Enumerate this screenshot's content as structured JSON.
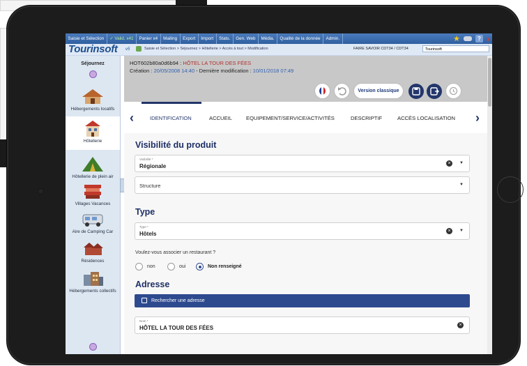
{
  "menu": {
    "items": [
      "Saisie et Sélection",
      "Valid. x41",
      "Panier x4",
      "Mailing",
      "Export",
      "Import",
      "Stats.",
      "Gen. Web",
      "Média.",
      "Qualité de la donnée",
      "Admin."
    ],
    "help_label": "?",
    "close_label": "x"
  },
  "brand": {
    "logo": "Tourinsoft",
    "version": "v5",
    "breadcrumb": "Saisie et Sélection > Séjournez > Hôtellerie > Accès à tout > Modification",
    "faire_savoir": "FAIRE SAVOIR CDT34 / CDT34",
    "tourinsoft_select": "Tourinsoft"
  },
  "sidebar": {
    "title": "Séjournez",
    "items": [
      {
        "label": "Hébergements locatifs",
        "icon": "chalet-icon"
      },
      {
        "label": "Hôtellerie",
        "icon": "hotel-icon",
        "active": true
      },
      {
        "label": "Hôtellerie de plein air",
        "icon": "tent-icon"
      },
      {
        "label": "Villages Vacances",
        "icon": "bungalow-icon"
      },
      {
        "label": "Aire de Camping Car",
        "icon": "camper-icon"
      },
      {
        "label": "Résidences",
        "icon": "houses-icon"
      },
      {
        "label": "Hébergements collectifs",
        "icon": "buildings-icon"
      }
    ]
  },
  "header": {
    "id_code": "HOT602b80a0d6b94 : ",
    "id_name": "HÔTEL LA TOUR DES FÉES",
    "creation_label": "Création : ",
    "creation_date": "20/05/2008 14:40",
    "modif_label": " - Dernière modification : ",
    "modif_date": "10/01/2018 07:49",
    "version_button": "Version classique"
  },
  "tabs": {
    "items": [
      "IDENTIFICATION",
      "ACCUEIL",
      "EQUIPEMENT/SERVICE/ACTIVITÉS",
      "DESCRIPTIF",
      "ACCÈS LOCALISATION"
    ],
    "active": "IDENTIFICATION"
  },
  "form": {
    "visibility_title": "Visibilité du produit",
    "visibility_label": "Visibilité *",
    "visibility_value": "Régionale",
    "structure_placeholder": "Structure",
    "type_title": "Type",
    "type_label": "Type *",
    "type_value": "Hôtels",
    "restaurant_question": "Voulez-vous associer un restaurant ?",
    "radio_options": [
      "non",
      "oui",
      "Non renseigné"
    ],
    "radio_selected": "Non renseigné",
    "address_title": "Adresse",
    "search_address_button": "Rechercher une adresse",
    "nom_label": "Nom *",
    "nom_value": "HÔTEL LA TOUR DES FÉES"
  },
  "colors": {
    "navy": "#23366b",
    "menubar": "#3a6aab",
    "accent_red": "#b03030"
  }
}
